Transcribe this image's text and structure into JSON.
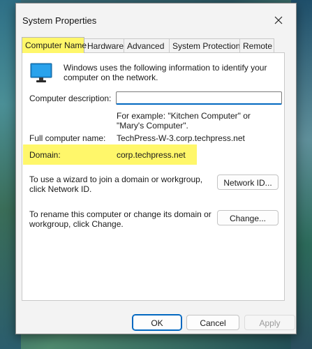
{
  "window": {
    "title": "System Properties"
  },
  "tabs": [
    {
      "label": "Computer Name",
      "active": true
    },
    {
      "label": "Hardware"
    },
    {
      "label": "Advanced"
    },
    {
      "label": "System Protection"
    },
    {
      "label": "Remote"
    }
  ],
  "computer_name": {
    "intro": "Windows uses the following information to identify your computer on the network.",
    "description_label": "Computer description:",
    "description_value": "",
    "example": "For example: \"Kitchen Computer\" or \"Mary's Computer\".",
    "full_name_label": "Full computer name:",
    "full_name_value": "TechPress-W-3.corp.techpress.net",
    "domain_label": "Domain:",
    "domain_value": "corp.techpress.net",
    "network_id_text": "To use a wizard to join a domain or workgroup, click Network ID.",
    "network_id_button": "Network ID...",
    "rename_text": "To rename this computer or change its domain or workgroup, click Change.",
    "change_button": "Change..."
  },
  "footer": {
    "ok": "OK",
    "cancel": "Cancel",
    "apply": "Apply"
  },
  "colors": {
    "highlight": "#fff76a",
    "accent": "#0067c0",
    "monitor": "#1e8fd8"
  },
  "icons": {
    "close": "close-icon",
    "computer": "monitor-icon"
  }
}
